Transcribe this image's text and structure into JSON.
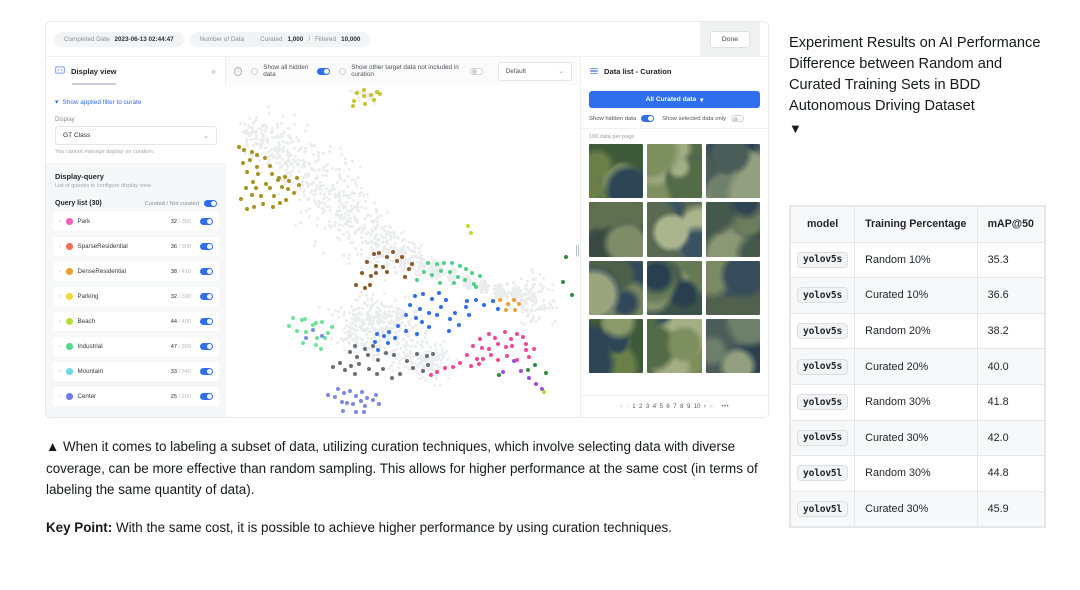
{
  "app": {
    "topbar": {
      "completed_label": "Completed Date",
      "completed_value": "2023-06-13 02:44:47",
      "number_label": "Number of Data",
      "curated_label": "Curated",
      "curated_value": "1,000",
      "slash": "/",
      "filtered_label": "Filtered",
      "filtered_value": "10,000",
      "done_label": "Done"
    },
    "toolbar": {
      "display_view_title": "Display view",
      "collapse_icon": "«",
      "show_all_hidden": "Show all hidden data",
      "show_other_target": "Show other target data not included in curation",
      "select_value": "Default",
      "data_list_title": "Data list - Curation"
    },
    "sidebar": {
      "filter_btn": "Show applied filter to curate",
      "display_label": "Display",
      "display_value": "GT Class",
      "display_hint": "You cannot manage display on curation.",
      "dq_title": "Display-query",
      "dq_sub": "List of queries to configure display view.",
      "query_list_title": "Query list (30)",
      "curated_toggle_label": "Curated / Not curated",
      "queries": [
        {
          "name": "Park",
          "color": "#f061c0",
          "curated": "32",
          "total": "350"
        },
        {
          "name": "SparseResidential",
          "color": "#f0704f",
          "curated": "36",
          "total": "300"
        },
        {
          "name": "DenseResidential",
          "color": "#f0a02e",
          "curated": "38",
          "total": "410"
        },
        {
          "name": "Parking",
          "color": "#f2d93a",
          "curated": "32",
          "total": "390"
        },
        {
          "name": "Beach",
          "color": "#b5dd3a",
          "curated": "44",
          "total": "400"
        },
        {
          "name": "Industrial",
          "color": "#54d98a",
          "curated": "47",
          "total": "390"
        },
        {
          "name": "Mountain",
          "color": "#6fd8ee",
          "curated": "33",
          "total": "340"
        },
        {
          "name": "Center",
          "color": "#6f7ce8",
          "curated": "25",
          "total": "260"
        }
      ]
    },
    "datalist": {
      "all_curated_label": "All Curated data",
      "show_hidden": "Show hidden data",
      "show_selected_only": "Show selected data only",
      "per_page": "100 data per page",
      "pages": [
        "1",
        "2",
        "3",
        "4",
        "5",
        "6",
        "7",
        "8",
        "9",
        "10"
      ],
      "first_icon": "«",
      "prev_icon": "‹",
      "next_icon": "›",
      "last_icon": "»",
      "more_icon": "•••"
    }
  },
  "headline": {
    "text": "Experiment Results on AI Performance Difference between Random and Curated Training Sets in BDD Autonomous Driving Dataset",
    "triangle": "▼"
  },
  "table": {
    "headers": [
      "model",
      "Training Percentage",
      "mAP@50"
    ],
    "rows": [
      {
        "model": "yolov5s",
        "training": "Random 10%",
        "map": "35.3"
      },
      {
        "model": "yolov5s",
        "training": "Curated 10%",
        "map": "36.6"
      },
      {
        "model": "yolov5s",
        "training": "Random 20%",
        "map": "38.2"
      },
      {
        "model": "yolov5s",
        "training": "Curated 20%",
        "map": "40.0"
      },
      {
        "model": "yolov5s",
        "training": "Random 30%",
        "map": "41.8"
      },
      {
        "model": "yolov5s",
        "training": "Curated 30%",
        "map": "42.0"
      },
      {
        "model": "yolov5l",
        "training": "Random 30%",
        "map": "44.8"
      },
      {
        "model": "yolov5l",
        "training": "Curated 30%",
        "map": "45.9"
      }
    ]
  },
  "caption": {
    "p1": "▲ When it comes to labeling a subset of data, utilizing curation techniques, which involve selecting data with diverse coverage, can be more effective than random sampling. This allows for higher performance at the same cost (in terms of labeling the same quantity of data).",
    "key_label": "Key Point:",
    "p2": " With the same cost, it is possible to achieve higher performance by using curation techniques."
  }
}
